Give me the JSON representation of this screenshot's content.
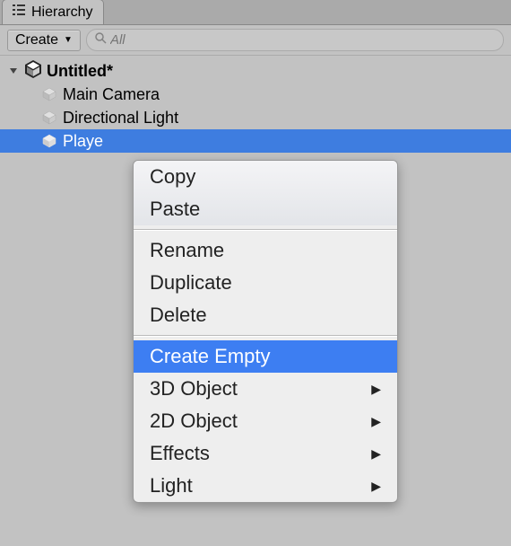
{
  "panel": {
    "tab_label": "Hierarchy"
  },
  "toolbar": {
    "create_label": "Create",
    "search_placeholder": "All"
  },
  "tree": {
    "scene_name": "Untitled*",
    "items": [
      {
        "label": "Main Camera"
      },
      {
        "label": "Directional Light"
      },
      {
        "label": "Playe"
      }
    ],
    "selected_index": 2
  },
  "context_menu": {
    "groups": [
      {
        "items": [
          {
            "label": "Copy"
          },
          {
            "label": "Paste"
          }
        ]
      },
      {
        "items": [
          {
            "label": "Rename"
          },
          {
            "label": "Duplicate"
          },
          {
            "label": "Delete"
          }
        ]
      },
      {
        "items": [
          {
            "label": "Create Empty",
            "highlighted": true
          },
          {
            "label": "3D Object",
            "submenu": true
          },
          {
            "label": "2D Object",
            "submenu": true
          },
          {
            "label": "Effects",
            "submenu": true
          },
          {
            "label": "Light",
            "submenu": true
          }
        ]
      }
    ]
  }
}
